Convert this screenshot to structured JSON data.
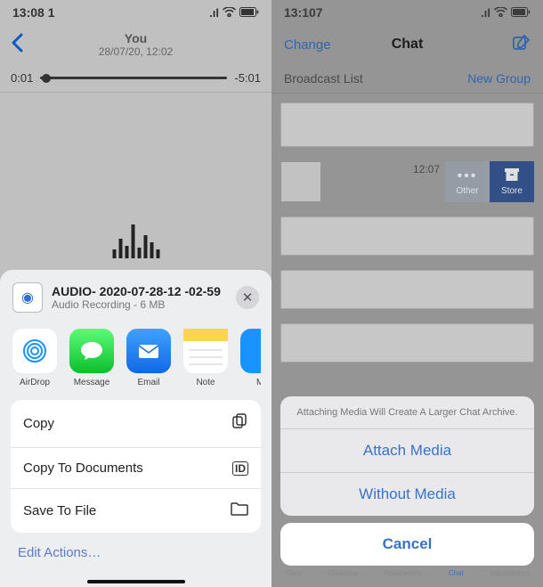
{
  "left": {
    "status": {
      "time": "13:08 1",
      "indicators": "📶 📶 🔋"
    },
    "nav": {
      "title": "You",
      "subtitle": "28/07/20, 12:02"
    },
    "player": {
      "elapsed": "0:01",
      "remaining": "-5:01"
    },
    "sheet": {
      "filename": "AUDIO- 2020-07-28-12 -02-59",
      "filemeta": "Audio Recording - 6 MB",
      "apps": [
        {
          "name": "AirDrop"
        },
        {
          "name": "Message"
        },
        {
          "name": "Email"
        },
        {
          "name": "Note"
        },
        {
          "name": "Me"
        }
      ],
      "actions": {
        "copy": "Copy",
        "copyDocs": "Copy To Documents",
        "saveFile": "Save To File"
      },
      "editActions": "Edit Actions…"
    }
  },
  "right": {
    "status": {
      "time": "13:107"
    },
    "nav": {
      "change": "Change",
      "title": "Chat"
    },
    "sublist": {
      "left": "Broadcast List",
      "right": "New Group"
    },
    "swipe": {
      "time": "12:07",
      "other": "Other",
      "store": "Store"
    },
    "actionSheet": {
      "desc": "Attaching Media Will Create A Larger Chat Archive.",
      "attach": "Attach Media",
      "without": "Without Media",
      "cancel": "Cancel"
    },
    "tabs": {
      "stato": "Stato",
      "chiamate": "Chiamate",
      "fotocamera": "Fotocamera",
      "chat": "Chat",
      "impostazioni": "Impostazioni"
    }
  }
}
